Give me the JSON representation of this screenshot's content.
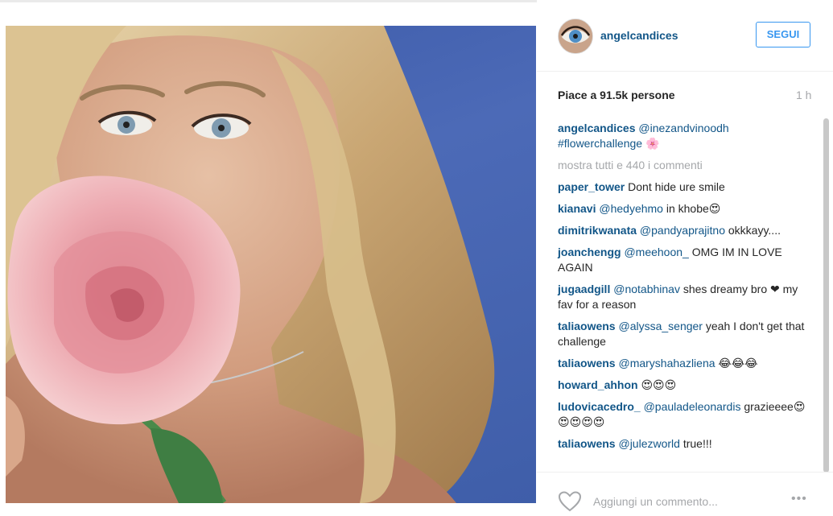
{
  "post": {
    "username": "angelcandices",
    "follow_label": "SEGUI",
    "likes_text": "Piace a 91.5k persone",
    "time_ago": "1 h",
    "caption": {
      "user": "angelcandices",
      "mention": "@inezandvinoodh",
      "tag": "#flowerchallenge",
      "emoji": "🌸"
    },
    "show_all_comments": "mostra tutti e 440 i commenti",
    "comments": [
      {
        "user": "paper_tower",
        "mention": "",
        "text": "Dont hide ure smile"
      },
      {
        "user": "kianavi",
        "mention": "@hedyehmo",
        "text": "in khobe😍"
      },
      {
        "user": "dimitrikwanata",
        "mention": "@pandyaprajitno",
        "text": "okkkayy...."
      },
      {
        "user": "joanchengg",
        "mention": "@meehoon_",
        "text": "OMG IM IN LOVE AGAIN"
      },
      {
        "user": "jugaadgill",
        "mention": "@notabhinav",
        "text": "shes dreamy bro ❤ my fav for a reason"
      },
      {
        "user": "taliaowens",
        "mention": "@alyssa_senger",
        "text": "yeah I don't get that challenge"
      },
      {
        "user": "taliaowens",
        "mention": "@maryshahazliena",
        "text": "😂😂😂"
      },
      {
        "user": "howard_ahhon",
        "mention": "",
        "text": "😍😍😍"
      },
      {
        "user": "ludovicacedro_",
        "mention": "@pauladeleonardis",
        "text": "grazieeee😍😍😍😍😍"
      },
      {
        "user": "taliaowens",
        "mention": "@julezworld",
        "text": "true!!!"
      }
    ],
    "add_comment_placeholder": "Aggiungi un commento...",
    "more_options": "•••"
  },
  "icons": {
    "like": "heart-icon",
    "more": "more-options-icon"
  },
  "colors": {
    "link": "#125688",
    "follow": "#3897f0",
    "muted": "#a5a7aa",
    "background_blue": "#4563b0"
  }
}
